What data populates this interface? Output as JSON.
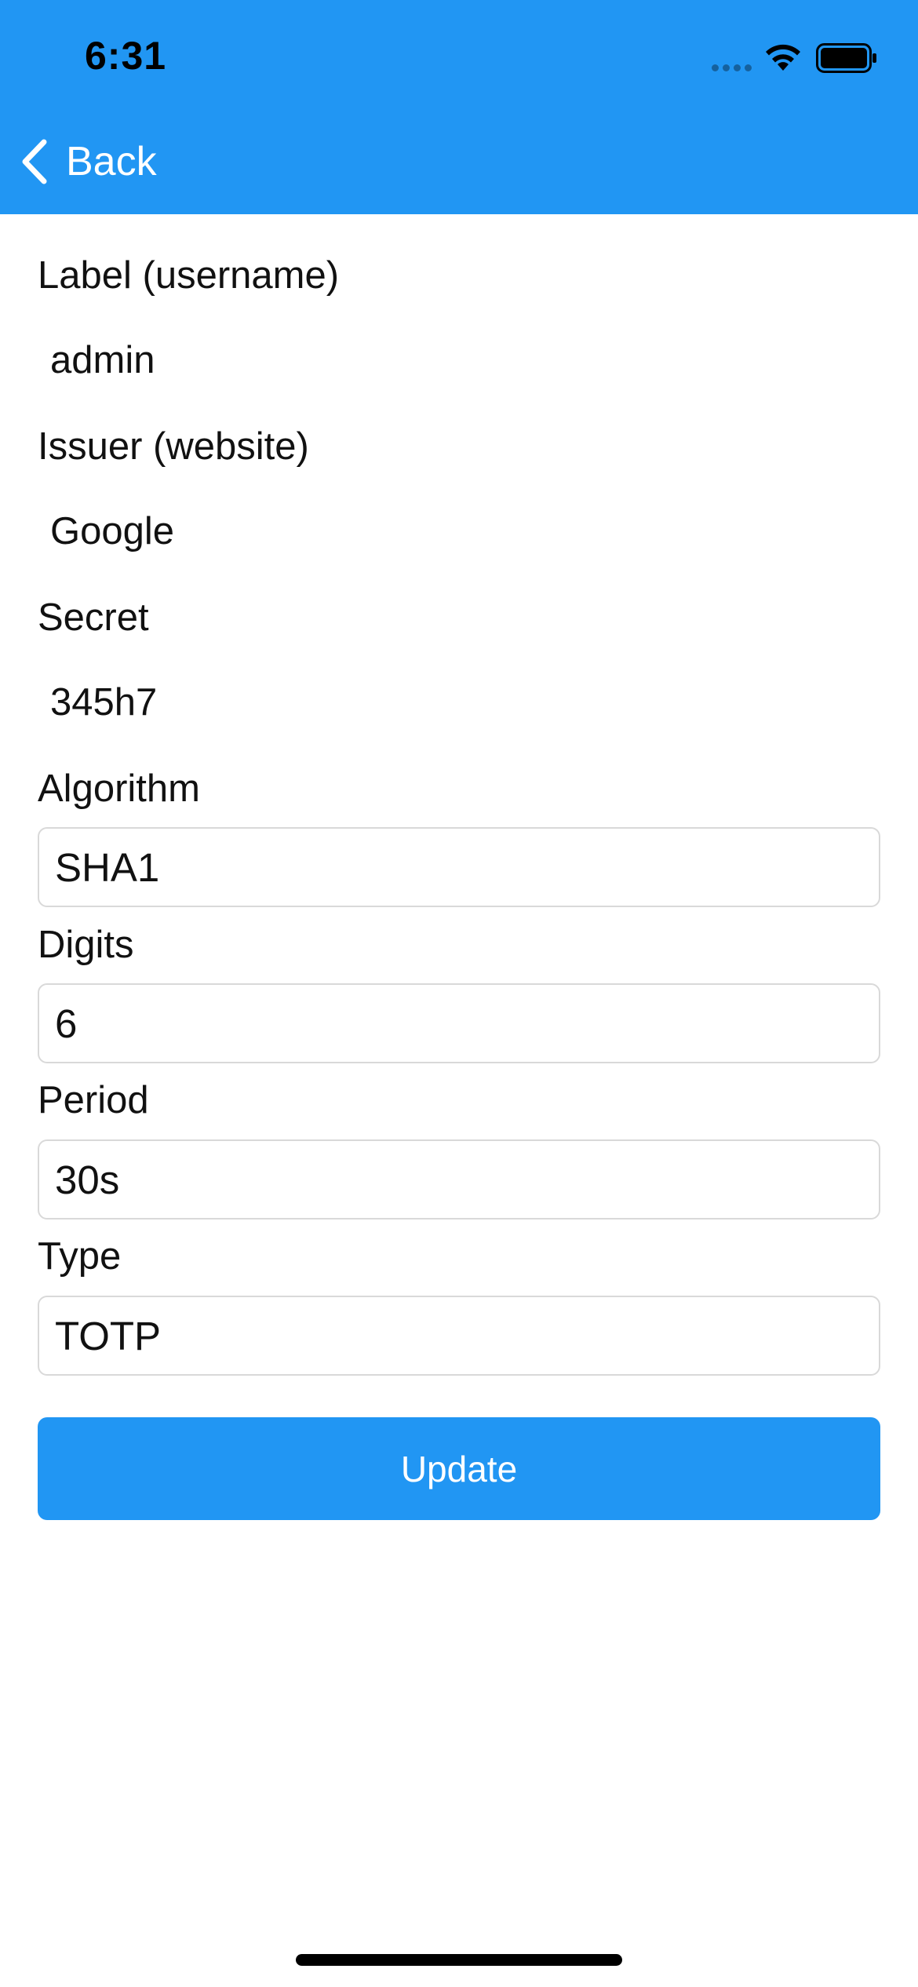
{
  "status_bar": {
    "time": "6:31"
  },
  "nav": {
    "back_label": "Back",
    "icon": "chevron-left-icon"
  },
  "form": {
    "label_field": {
      "label": "Label (username)",
      "value": "admin"
    },
    "issuer_field": {
      "label": "Issuer (website)",
      "value": "Google"
    },
    "secret_field": {
      "label": "Secret",
      "value": "345h7"
    },
    "algorithm_field": {
      "label": "Algorithm",
      "value": "SHA1"
    },
    "digits_field": {
      "label": "Digits",
      "value": "6"
    },
    "period_field": {
      "label": "Period",
      "value": "30s"
    },
    "type_field": {
      "label": "Type",
      "value": "TOTP"
    }
  },
  "actions": {
    "update_label": "Update"
  },
  "colors": {
    "accent": "#2196F3",
    "text": "#111111",
    "border": "#d9d9d9"
  }
}
